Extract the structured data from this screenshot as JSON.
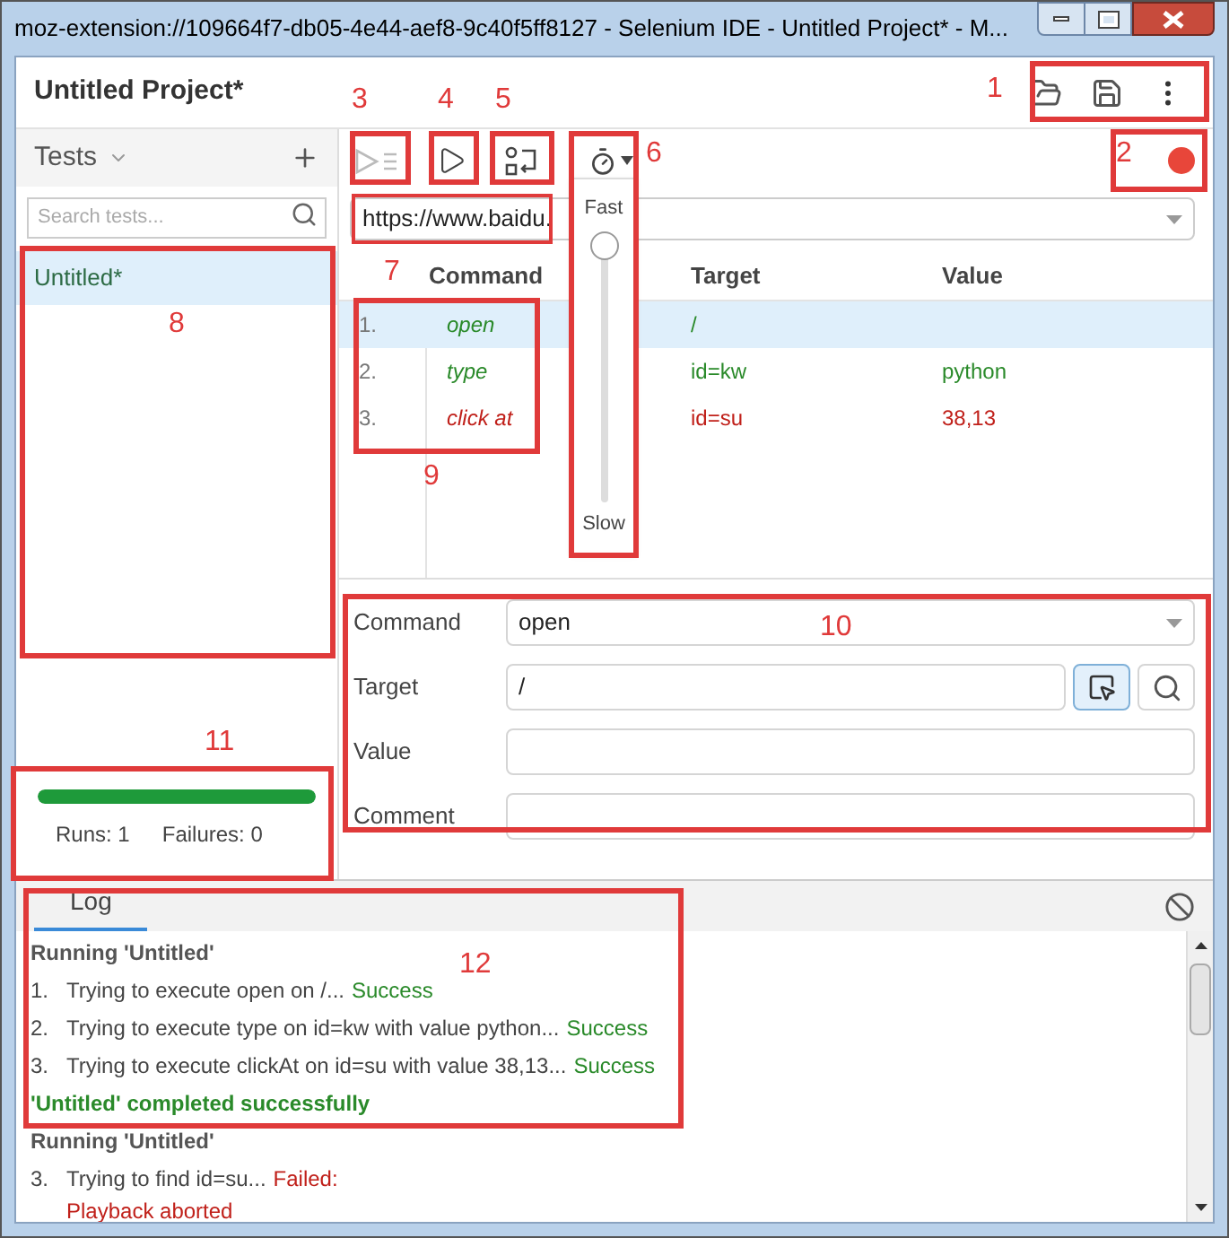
{
  "window": {
    "title": "moz-extension://109664f7-db05-4e44-aef8-9c40f5ff8127 - Selenium IDE - Untitled Project* - M..."
  },
  "project": {
    "title": "Untitled Project*"
  },
  "tests_panel": {
    "title": "Tests",
    "search": {
      "placeholder": "Search tests..."
    },
    "items": [
      {
        "label": "Untitled*",
        "selected": true
      }
    ],
    "progress": {
      "level": 1
    },
    "runs": "Runs: 1",
    "failures": "Failures: 0"
  },
  "toolbar": {
    "base_url": "https://www.baidu."
  },
  "speed": {
    "fast": "Fast",
    "slow": "Slow",
    "level": 1
  },
  "table": {
    "columns": [
      "Command",
      "Target",
      "Value"
    ],
    "rows": [
      {
        "index": "1.",
        "command": "open",
        "target": "/",
        "color": "#2a8a2a",
        "selected": true
      },
      {
        "index": "2.",
        "command": "type",
        "target": "id=kw",
        "value": "python",
        "color": "#2a8a2a",
        "selected": false
      },
      {
        "index": "3.",
        "command": "click at",
        "target": "id=su",
        "value": "38,13",
        "color": "#c0201a",
        "selected": false
      }
    ]
  },
  "editor": {
    "command": {
      "label": "Command",
      "value": "open"
    },
    "target": {
      "label": "Target",
      "value": "/"
    },
    "value": {
      "label": "Value"
    },
    "comment": {
      "label": "Comment"
    }
  },
  "log": {
    "tab": "Log",
    "entries": [
      {
        "kind": "heading",
        "text": "Running 'Untitled'"
      },
      {
        "kind": "step",
        "index": "1.",
        "text": "Trying to execute open on /...",
        "result": "Success",
        "color": "#2a8a2a"
      },
      {
        "kind": "step",
        "index": "2.",
        "text": "Trying to execute type on id=kw with value python...",
        "result": "Success",
        "color": "#2a8a2a"
      },
      {
        "kind": "step",
        "index": "3.",
        "text": "Trying to execute clickAt on id=su with value 38,13...",
        "result": "Success",
        "color": "#2a8a2a"
      },
      {
        "kind": "done",
        "text": "'Untitled' completed successfully"
      },
      {
        "kind": "heading",
        "text": "Running 'Untitled'"
      },
      {
        "kind": "step",
        "index": "3.",
        "text": "Trying to find id=su...",
        "result": "Failed:",
        "color": "#c0201a",
        "detail": "Playback aborted"
      }
    ]
  },
  "annotations": [
    {
      "label": "1"
    },
    {
      "label": "2"
    },
    {
      "label": "3"
    },
    {
      "label": "4"
    },
    {
      "label": "5"
    },
    {
      "label": "6"
    },
    {
      "label": "7"
    },
    {
      "label": "8"
    },
    {
      "label": "9"
    },
    {
      "label": "10"
    },
    {
      "label": "11"
    },
    {
      "label": "12"
    }
  ]
}
